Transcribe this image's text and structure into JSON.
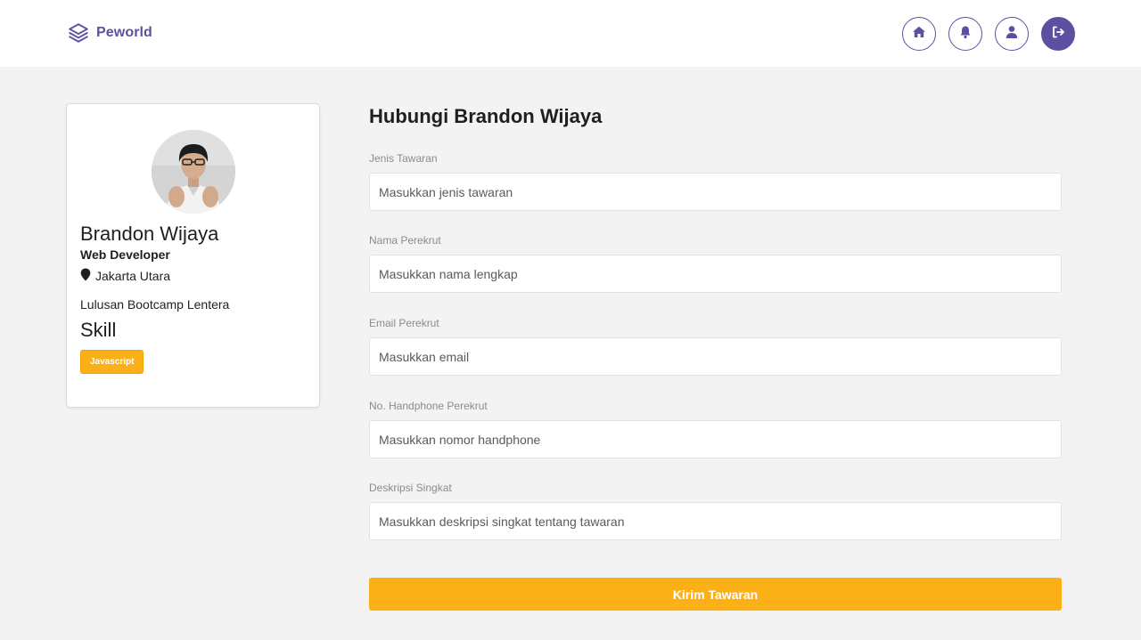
{
  "navbar": {
    "brand": "Peworld",
    "icons": [
      "home-icon",
      "bell-icon",
      "user-icon",
      "logout-icon"
    ]
  },
  "profile": {
    "name": "Brandon Wijaya",
    "job": "Web Developer",
    "location": "Jakarta Utara",
    "bio": "Lulusan Bootcamp Lentera",
    "skill_title": "Skill",
    "skills": [
      "Javascript"
    ]
  },
  "form": {
    "title": "Hubungi Brandon Wijaya",
    "fields": [
      {
        "label": "Jenis Tawaran",
        "placeholder": "Masukkan jenis tawaran"
      },
      {
        "label": "Nama Perekrut",
        "placeholder": "Masukkan nama lengkap"
      },
      {
        "label": "Email Perekrut",
        "placeholder": "Masukkan email"
      },
      {
        "label": "No. Handphone Perekrut",
        "placeholder": "Masukkan nomor handphone"
      },
      {
        "label": "Deskripsi Singkat",
        "placeholder": "Masukkan deskripsi singkat tentang tawaran"
      }
    ],
    "submit_label": "Kirim Tawaran"
  },
  "colors": {
    "primary": "#5e50a1",
    "accent": "#fbb017",
    "background": "#f3f3f3"
  }
}
